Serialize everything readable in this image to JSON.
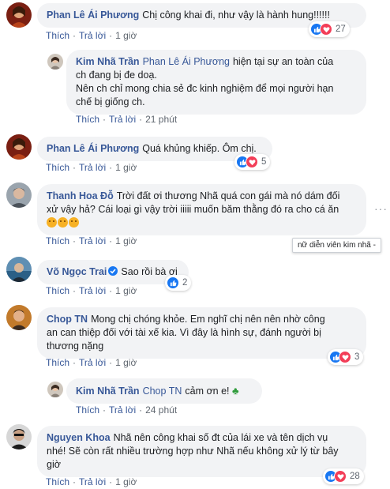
{
  "actions": {
    "like": "Thích",
    "reply": "Trả lời",
    "dot": "·"
  },
  "tooltip": "nữ diễn viên kim nhã -",
  "comments": [
    {
      "author": "Phan Lê Ái Phương",
      "text": "Chị công khai đi, như vậy là hành hung!!!!!!",
      "time": "1 giờ",
      "reactions": {
        "icons": [
          "like-icon",
          "love-icon"
        ],
        "count": "27"
      }
    },
    {
      "author": "Kim Nhã Trần",
      "mention": "Phan Lê Ái Phương",
      "text_line1": "hiện tại sự an toàn của",
      "text_line2": "ch đang bị đe doạ.",
      "text_line3": "Nên ch chỉ mong chia sẻ đc kinh nghiệm để mọi người hạn",
      "text_line4": "chế bị giống ch.",
      "time": "21 phút"
    },
    {
      "author": "Phan Lê Ái Phương",
      "text": "Quá khủng khiếp. Ôm chị.",
      "time": "1 giờ",
      "reactions": {
        "icons": [
          "like-icon",
          "love-icon"
        ],
        "count": "5"
      }
    },
    {
      "author": "Thanh Hoa Đỗ",
      "text_line1": "Trời đất ơi thương Nhã quá con gái mà nó dám đối",
      "text_line2": "xử vậy hả? Cái loại gì vậy trời iiiii muốn băm thằng đó ra cho cá ăn",
      "time": "1 giờ"
    },
    {
      "author": "Võ Ngọc Trai",
      "text": "Sao rồi bà ơi",
      "time": "1 giờ",
      "reactions": {
        "icons": [
          "like-icon"
        ],
        "count": "2"
      }
    },
    {
      "author": "Chop TN",
      "text_line1": "Mong chị chóng khỏe. Em nghĩ chị nên nên nhờ công",
      "text_line2": "an can thiệp đối với tài xế kia. Vì đây là hình sự, đánh người bị",
      "text_line3": "thương nặng",
      "time": "1 giờ",
      "reactions": {
        "icons": [
          "like-icon",
          "love-icon"
        ],
        "count": "3"
      }
    },
    {
      "author": "Kim Nhã Trần",
      "mention": "Chop TN",
      "text": "cảm ơn e!",
      "time": "24 phút"
    },
    {
      "author": "Nguyen Khoa",
      "text_line1": "Nhã nên công khai số đt của lái xe và tên dịch vụ",
      "text_line2": "nhé! Sẽ còn rất nhiều trường hợp như Nhã nếu không xử lý từ bây",
      "text_line3": "giờ",
      "time": "1 giờ",
      "reactions": {
        "icons": [
          "like-icon",
          "love-icon"
        ],
        "count": "28"
      }
    }
  ]
}
